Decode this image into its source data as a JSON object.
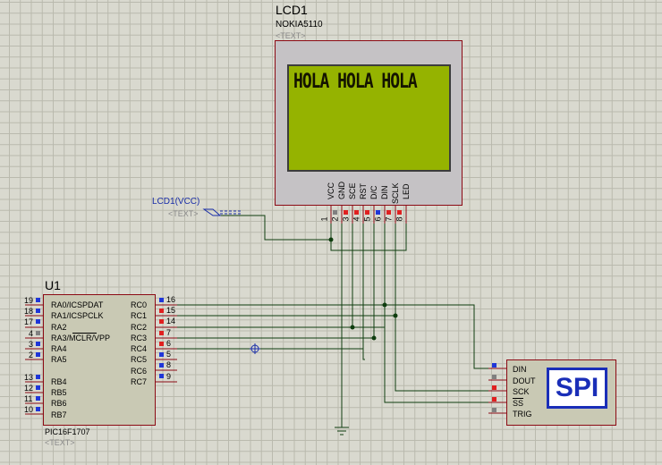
{
  "lcd": {
    "ref": "LCD1",
    "model": "NOKIA5110",
    "text_placeholder": "<TEXT>",
    "display": "HOLA HOLA HOLA",
    "pins": [
      {
        "name": "VCC",
        "num": "1"
      },
      {
        "name": "GND",
        "num": "2"
      },
      {
        "name": "SCE",
        "num": "3"
      },
      {
        "name": "RST",
        "num": "4"
      },
      {
        "name": "D/C",
        "num": "5"
      },
      {
        "name": "DIN",
        "num": "6"
      },
      {
        "name": "SCLK",
        "num": "7"
      },
      {
        "name": "LED",
        "num": "8"
      }
    ]
  },
  "terminal": {
    "label": "LCD1(VCC)",
    "placeholder": "<TEXT>"
  },
  "mcu": {
    "ref": "U1",
    "model": "PIC16F1707",
    "text_placeholder": "<TEXT>",
    "left_pins": [
      {
        "num": "19",
        "name": "RA0/ICSPDAT"
      },
      {
        "num": "18",
        "name": "RA1/ICSPCLK"
      },
      {
        "num": "17",
        "name": "RA2"
      },
      {
        "num": "4",
        "name": "RA3/MCLR/VPP"
      },
      {
        "num": "3",
        "name": "RA4"
      },
      {
        "num": "2",
        "name": "RA5"
      },
      {
        "num": "13",
        "name": "RB4"
      },
      {
        "num": "12",
        "name": "RB5"
      },
      {
        "num": "11",
        "name": "RB6"
      },
      {
        "num": "10",
        "name": "RB7"
      }
    ],
    "right_pins": [
      {
        "num": "16",
        "name": "RC0"
      },
      {
        "num": "15",
        "name": "RC1"
      },
      {
        "num": "14",
        "name": "RC2"
      },
      {
        "num": "7",
        "name": "RC3"
      },
      {
        "num": "6",
        "name": "RC4"
      },
      {
        "num": "5",
        "name": "RC5"
      },
      {
        "num": "8",
        "name": "RC6"
      },
      {
        "num": "9",
        "name": "RC7"
      }
    ]
  },
  "spi": {
    "logo": "SPI",
    "pins": [
      "DIN",
      "DOUT",
      "SCK",
      "SS",
      "TRIG"
    ]
  },
  "colors": {
    "wire": "#0f3d0f",
    "pin_blue": "#1f36d8",
    "pin_red": "#e02020",
    "component_border": "#8c0a14",
    "lcd_screen": "#95b300"
  }
}
